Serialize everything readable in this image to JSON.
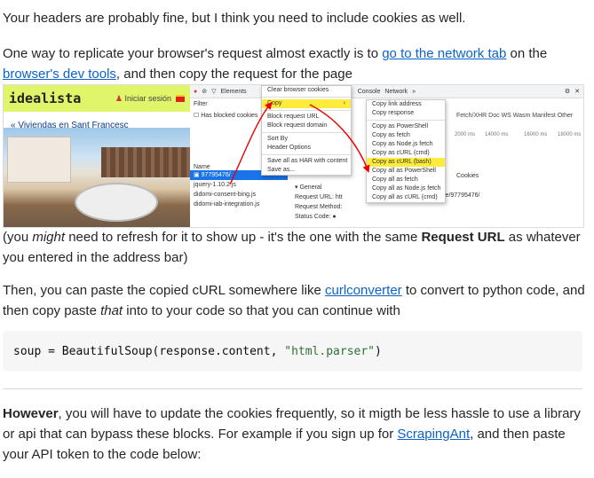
{
  "p1": "Your headers are probably fine, but I think you need to include cookies as well.",
  "p2": {
    "a": "One way to replicate your browser's request almost exactly is to ",
    "link1": "go to the network tab",
    "b": " on the",
    "link2": "browser's dev tools",
    "c": ", and then copy the request for the page"
  },
  "screenshot": {
    "site": {
      "logo": "idealista",
      "login": "Iniciar sesión",
      "breadcrumb": "« Viviendas en Sant Francesc"
    },
    "devtools": {
      "toolbar": [
        "Elements",
        "Console",
        "Network",
        "»"
      ],
      "filter": "Filter",
      "has_blocked": "Has blocked cookies",
      "name_header": "Name",
      "selected_request": "97795476/",
      "files": [
        "jquery-1.10.2.js",
        "didomi-consent-bing.js",
        "didomi-iab-integration.js"
      ],
      "tabs": "Fetch/XHR  Doc  WS  Wasm  Manifest  Other",
      "timeline": [
        "2000 ms",
        "14000 ms",
        "16000 ms",
        "18000 ms"
      ],
      "general": [
        "▾ General",
        "Request URL: htt",
        "Request Method:",
        "Status Code: ●"
      ],
      "side_tab": "Cookies",
      "side_url": "le/97795476/"
    },
    "menu1": [
      "Clear browser cookies",
      "Copy",
      "Block request URL",
      "Block request domain",
      "Sort By",
      "Header Options",
      "Save all as HAR with content",
      "Save as..."
    ],
    "menu2": [
      "Copy link address",
      "Copy response",
      "Copy as PowerShell",
      "Copy as fetch",
      "Copy as Node.js fetch",
      "Copy as cURL (cmd)",
      "Copy as cURL (bash)",
      "Copy all as PowerShell",
      "Copy all as fetch",
      "Copy all as Node.js fetch",
      "Copy all as cURL (cmd)"
    ]
  },
  "p3": {
    "a": "(you ",
    "em": "might",
    "b": " need to refresh for it to show up - it's the one with the same ",
    "strong": "Request URL",
    "c": " as whatever",
    "line2": "you entered in the address bar)"
  },
  "p4": {
    "a": "Then, you can paste the copied cURL somewhere like ",
    "link": "curlconverter",
    "b": " to convert to python code, and",
    "c": "then copy paste ",
    "em": "that",
    "d": " into to your code so that you can continue with"
  },
  "code": {
    "pre": "soup = BeautifulSoup(response.content, ",
    "str": "\"html.parser\"",
    "post": ")"
  },
  "p5": {
    "strong": "However",
    "a": ", you will have to update the cookies frequently, so it migth be less hassle to use a library",
    "b": "or api that can bypass these blocks. For example if you sign up for ",
    "link": "ScrapingAnt",
    "c": ", and then paste",
    "d": "your API token to the code below:"
  }
}
